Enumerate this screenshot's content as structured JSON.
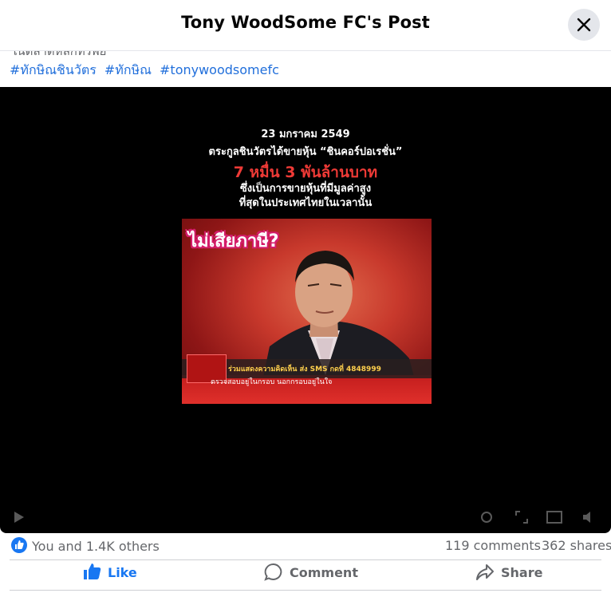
{
  "header": {
    "title": "Tony WoodSome FC's Post",
    "close_icon": "close-icon"
  },
  "post": {
    "cut_off_text": "ในตลาดหลักทรัพย์",
    "hashtags": [
      "#ทักษิณชินวัตร",
      "#ทักษิณ",
      "#tonywoodsomefc"
    ]
  },
  "video": {
    "caption_date": "23 มกราคม 2549",
    "caption_line2": "ตระกูลชินวัตรได้ขายหุ้น “ชินคอร์ปอเรชั่น”",
    "caption_amount": "7 หมื่น 3 พันล้านบาท",
    "caption_line4": "ซึ่งเป็นการขายหุ้นที่มีมูลค่าสูง",
    "caption_line5": "ที่สุดในประเทศไทยในเวลานั้น",
    "frame_title": "ไม่เสียภาษี?",
    "ticker_text": "ร่วมแสดงความคิดเห็น ส่ง SMS กดที่ 4848999",
    "subticker_text": "ตรวจสอบอยู่ในกรอบ นอกกรอบอยู่ในใจ",
    "accent_color": "#ee3a36"
  },
  "stats": {
    "reactions": "You and 1.4K others",
    "comments": "119 comments",
    "shares": "362 shares"
  },
  "actions": {
    "like": "Like",
    "comment": "Comment",
    "share": "Share"
  },
  "colors": {
    "brand": "#1877f2",
    "hashtag": "#216fdb",
    "muted": "#65676b"
  }
}
